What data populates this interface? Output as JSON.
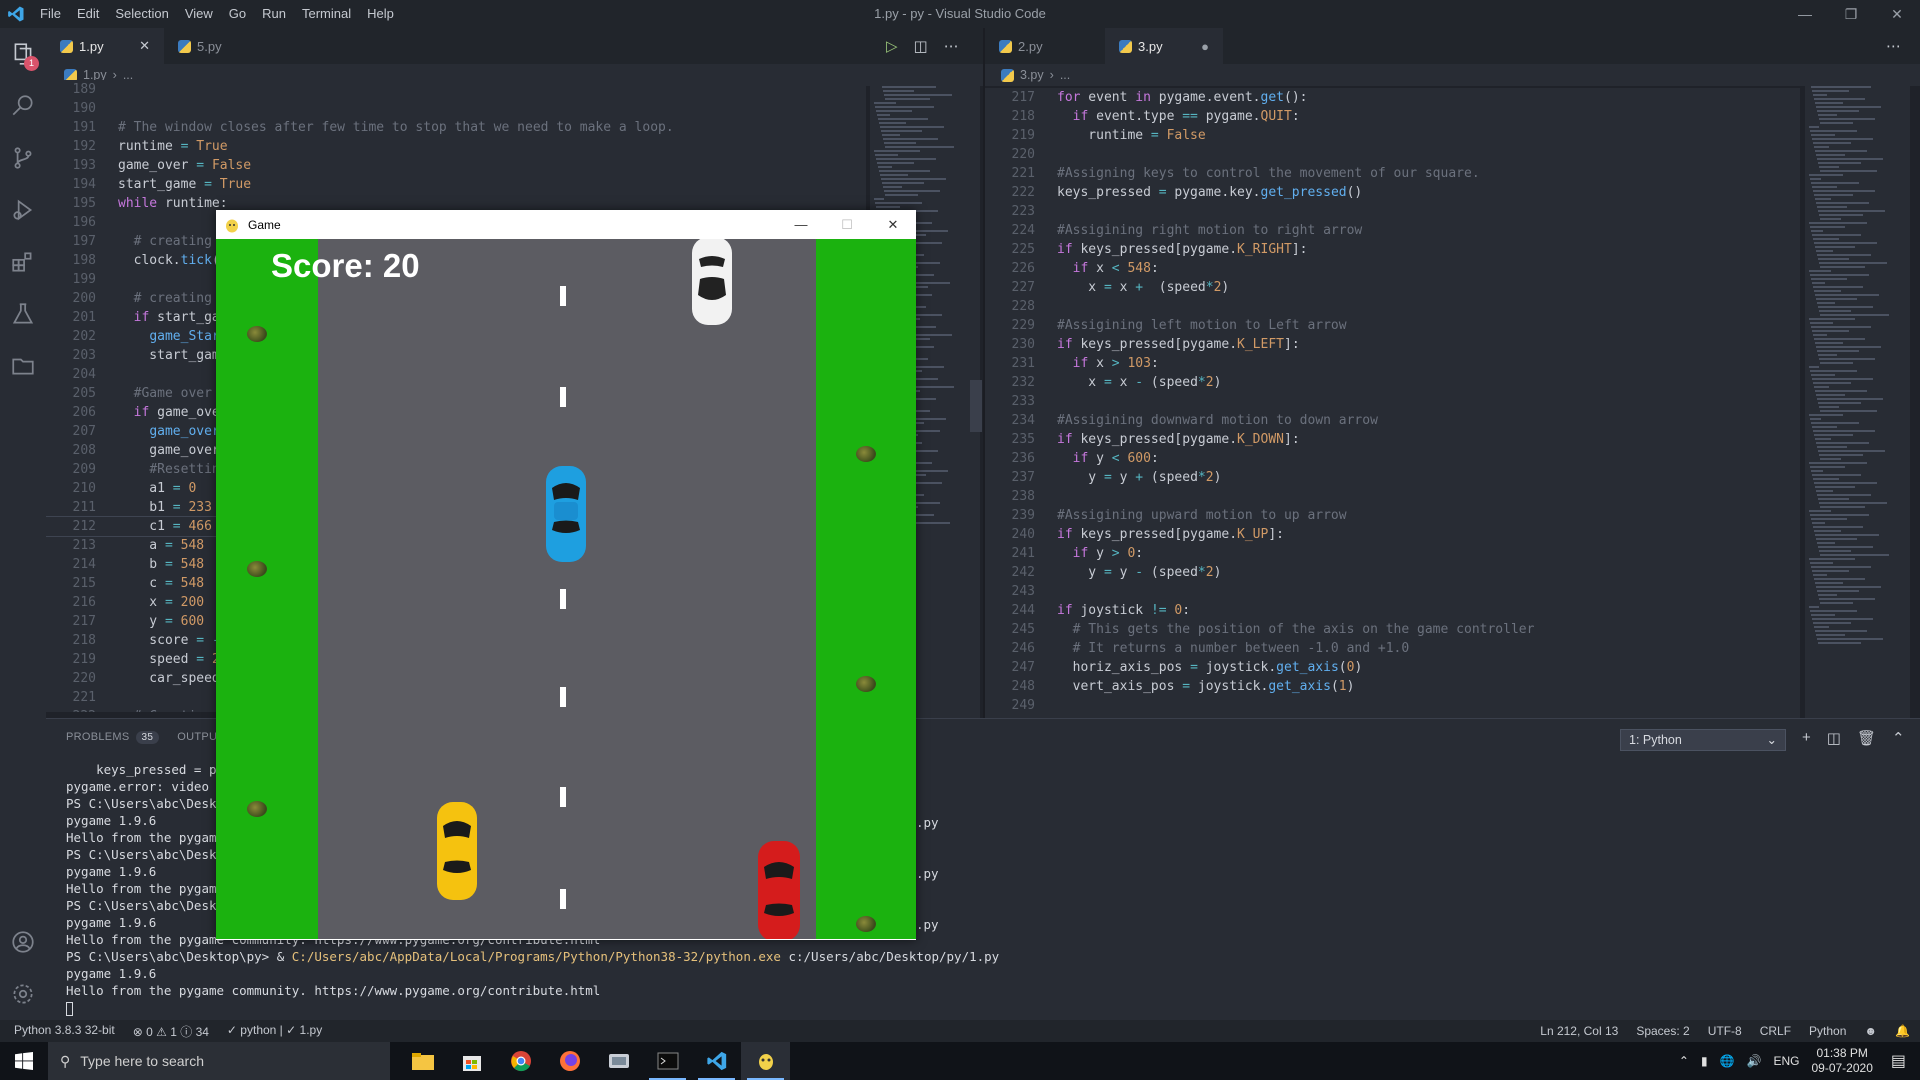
{
  "window": {
    "title": "1.py - py - Visual Studio Code"
  },
  "menu": [
    "File",
    "Edit",
    "Selection",
    "View",
    "Go",
    "Run",
    "Terminal",
    "Help"
  ],
  "activity": {
    "explorer_badge": "1"
  },
  "left_editor": {
    "tabs": [
      {
        "label": "1.py",
        "active": true
      },
      {
        "label": "5.py",
        "active": false
      }
    ],
    "breadcrumb": [
      "1.py",
      "..."
    ],
    "lines": [
      {
        "n": "189",
        "html": ""
      },
      {
        "n": "190",
        "html": ""
      },
      {
        "n": "191",
        "html": "<span class='cm'># The window closes after few time to stop that we need to make a loop.</span>"
      },
      {
        "n": "192",
        "html": "runtime <span class='op'>=</span> <span class='num'>True</span>"
      },
      {
        "n": "193",
        "html": "game_over <span class='op'>=</span> <span class='num'>False</span>"
      },
      {
        "n": "194",
        "html": "start_game <span class='op'>=</span> <span class='num'>True</span>"
      },
      {
        "n": "195",
        "html": "<span class='kw'>while</span> runtime:"
      },
      {
        "n": "196",
        "html": ""
      },
      {
        "n": "197",
        "html": "  <span class='cm'># creating</span>"
      },
      {
        "n": "198",
        "html": "  clock.<span class='fn'>tick</span>("
      },
      {
        "n": "199",
        "html": ""
      },
      {
        "n": "200",
        "html": "  <span class='cm'># creating</span>"
      },
      {
        "n": "201",
        "html": "  <span class='kw'>if</span> start_ga"
      },
      {
        "n": "202",
        "html": "    <span class='fn'>game_Star</span>"
      },
      {
        "n": "203",
        "html": "    start_gam"
      },
      {
        "n": "204",
        "html": ""
      },
      {
        "n": "205",
        "html": "  <span class='cm'>#Game over</span>"
      },
      {
        "n": "206",
        "html": "  <span class='kw'>if</span> game_ove"
      },
      {
        "n": "207",
        "html": "    <span class='fn'>game_over</span>"
      },
      {
        "n": "208",
        "html": "    game_over"
      },
      {
        "n": "209",
        "html": "    <span class='cm'>#Resettin</span>"
      },
      {
        "n": "210",
        "html": "    a1 <span class='op'>=</span> <span class='num'>0</span>"
      },
      {
        "n": "211",
        "html": "    b1 <span class='op'>=</span> <span class='num'>233</span>"
      },
      {
        "n": "212",
        "html": "    c1 <span class='op'>=</span> <span class='num'>466</span>"
      },
      {
        "n": "213",
        "html": "    a <span class='op'>=</span> <span class='num'>548</span>"
      },
      {
        "n": "214",
        "html": "    b <span class='op'>=</span> <span class='num'>548</span>"
      },
      {
        "n": "215",
        "html": "    c <span class='op'>=</span> <span class='num'>548</span>"
      },
      {
        "n": "216",
        "html": "    x <span class='op'>=</span> <span class='num'>200</span>"
      },
      {
        "n": "217",
        "html": "    y <span class='op'>=</span> <span class='num'>600</span>"
      },
      {
        "n": "218",
        "html": "    score <span class='op'>=</span> <span class='op'>-</span>"
      },
      {
        "n": "219",
        "html": "    speed <span class='op'>=</span> <span class='num'>2</span>"
      },
      {
        "n": "220",
        "html": "    car_speed"
      },
      {
        "n": "221",
        "html": ""
      },
      {
        "n": "222",
        "html": "  <span class='cm'># Creating</span>"
      }
    ]
  },
  "right_editor": {
    "tabs": [
      {
        "label": "2.py",
        "active": false
      },
      {
        "label": "3.py",
        "active": true,
        "dirty": true
      }
    ],
    "breadcrumb": [
      "3.py",
      "..."
    ],
    "lines": [
      {
        "n": "217",
        "html": "<span class='kw'>for</span> event <span class='kw'>in</span> pygame.event.<span class='fn'>get</span>():"
      },
      {
        "n": "218",
        "html": "  <span class='kw'>if</span> event.type <span class='op'>==</span> pygame.<span class='num'>QUIT</span>:"
      },
      {
        "n": "219",
        "html": "    runtime <span class='op'>=</span> <span class='num'>False</span>"
      },
      {
        "n": "220",
        "html": ""
      },
      {
        "n": "221",
        "html": "<span class='cm'>#Assigning keys to control the movement of our square.</span>"
      },
      {
        "n": "222",
        "html": "keys_pressed <span class='op'>=</span> pygame.key.<span class='fn'>get_pressed</span>()"
      },
      {
        "n": "223",
        "html": ""
      },
      {
        "n": "224",
        "html": "<span class='cm'>#Assigining right motion to right arrow</span>"
      },
      {
        "n": "225",
        "html": "<span class='kw'>if</span> keys_pressed[pygame.<span class='num'>K_RIGHT</span>]:"
      },
      {
        "n": "226",
        "html": "  <span class='kw'>if</span> x <span class='op'>&lt;</span> <span class='num'>548</span>:"
      },
      {
        "n": "227",
        "html": "    x <span class='op'>=</span> x <span class='op'>+</span>  (speed<span class='op'>*</span><span class='num'>2</span>)"
      },
      {
        "n": "228",
        "html": ""
      },
      {
        "n": "229",
        "html": "<span class='cm'>#Assigining left motion to Left arrow</span>"
      },
      {
        "n": "230",
        "html": "<span class='kw'>if</span> keys_pressed[pygame.<span class='num'>K_LEFT</span>]:"
      },
      {
        "n": "231",
        "html": "  <span class='kw'>if</span> x <span class='op'>&gt;</span> <span class='num'>103</span>:"
      },
      {
        "n": "232",
        "html": "    x <span class='op'>=</span> x <span class='op'>-</span> (speed<span class='op'>*</span><span class='num'>2</span>)"
      },
      {
        "n": "233",
        "html": ""
      },
      {
        "n": "234",
        "html": "<span class='cm'>#Assigining downward motion to down arrow</span>"
      },
      {
        "n": "235",
        "html": "<span class='kw'>if</span> keys_pressed[pygame.<span class='num'>K_DOWN</span>]:"
      },
      {
        "n": "236",
        "html": "  <span class='kw'>if</span> y <span class='op'>&lt;</span> <span class='num'>600</span>:"
      },
      {
        "n": "237",
        "html": "    y <span class='op'>=</span> y <span class='op'>+</span> (speed<span class='op'>*</span><span class='num'>2</span>)"
      },
      {
        "n": "238",
        "html": ""
      },
      {
        "n": "239",
        "html": "<span class='cm'>#Assigining upward motion to up arrow</span>"
      },
      {
        "n": "240",
        "html": "<span class='kw'>if</span> keys_pressed[pygame.<span class='num'>K_UP</span>]:"
      },
      {
        "n": "241",
        "html": "  <span class='kw'>if</span> y <span class='op'>&gt;</span> <span class='num'>0</span>:"
      },
      {
        "n": "242",
        "html": "    y <span class='op'>=</span> y <span class='op'>-</span> (speed<span class='op'>*</span><span class='num'>2</span>)"
      },
      {
        "n": "243",
        "html": ""
      },
      {
        "n": "244",
        "html": "<span class='kw'>if</span> joystick <span class='op'>!=</span> <span class='num'>0</span>:"
      },
      {
        "n": "245",
        "html": "  <span class='cm'># This gets the position of the axis on the game controller</span>"
      },
      {
        "n": "246",
        "html": "  <span class='cm'># It returns a number between -1.0 and +1.0</span>"
      },
      {
        "n": "247",
        "html": "  horiz_axis_pos <span class='op'>=</span> joystick.<span class='fn'>get_axis</span>(<span class='num'>0</span>)"
      },
      {
        "n": "248",
        "html": "  vert_axis_pos <span class='op'>=</span> joystick.<span class='fn'>get_axis</span>(<span class='num'>1</span>)"
      },
      {
        "n": "249",
        "html": ""
      }
    ]
  },
  "panel": {
    "tabs": {
      "problems": "PROBLEMS",
      "problems_count": "35",
      "output": "OUTPUT"
    },
    "terminal_select": "1: Python",
    "terminal_lines": [
      "    keys_pressed = py",
      "pygame.error: video s",
      "PS C:\\Users\\abc\\Deskt",
      "pygame 1.9.6",
      "Hello from the pygame",
      "PS C:\\Users\\abc\\Deskt",
      "pygame 1.9.6",
      "Hello from the pygame",
      "PS C:\\Users\\abc\\Deskt",
      "pygame 1.9.6",
      "Hello from the pygame community. https://www.pygame.org/contribute.html"
    ],
    "ps_prompt": "PS C:\\Users\\abc\\Desktop\\py> & ",
    "ps_exe": "C:/Users/abc/AppData/Local/Programs/Python/Python38-32/python.exe",
    "ps_arg": " c:/Users/abc/Desktop/py/1.py",
    "after_lines": [
      "pygame 1.9.6",
      "Hello from the pygame community. https://www.pygame.org/contribute.html"
    ],
    "right_fragment": ".py"
  },
  "status": {
    "interpreter": "Python 3.8.3 32-bit",
    "problems": "⊗ 0 ⚠ 1 ⓘ 34",
    "python_check": "✓ python | ✓ 1.py",
    "position": "Ln 212, Col 13",
    "spaces": "Spaces: 2",
    "encoding": "UTF-8",
    "eol": "CRLF",
    "language": "Python"
  },
  "taskbar": {
    "search_placeholder": "Type here to search",
    "lang": "ENG",
    "time": "01:38 PM",
    "date": "09-07-2020"
  },
  "game": {
    "title": "Game",
    "score_text": "Score: 20",
    "colors": {
      "grass": "#1bb20f",
      "road": "#5c5c62"
    },
    "cars": [
      {
        "color": "white",
        "lane": "right",
        "direction": "down"
      },
      {
        "color": "blue",
        "lane": "middle",
        "role": "player"
      },
      {
        "color": "yellow",
        "lane": "left"
      },
      {
        "color": "red",
        "lane": "right"
      }
    ]
  }
}
